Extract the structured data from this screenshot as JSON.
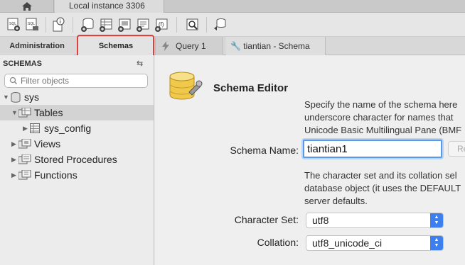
{
  "instance_tab": {
    "label": "Local instance 3306"
  },
  "toolbar": {
    "buttons": [
      "new-sql-tab-icon",
      "open-sql-script-icon",
      "inspector-icon",
      "create-schema-icon",
      "create-table-icon",
      "create-view-icon",
      "create-procedure-icon",
      "create-function-icon",
      "search-table-data-icon",
      "reconnect-icon"
    ]
  },
  "panel_tabs": {
    "administration": "Administration",
    "schemas": "Schemas"
  },
  "editor_tabs": [
    {
      "label": "Query 1"
    },
    {
      "label": "tiantian - Schema"
    }
  ],
  "sidebar": {
    "title": "SCHEMAS",
    "filter_placeholder": "Filter objects",
    "tree": [
      {
        "label": "sys"
      },
      {
        "label": "Tables"
      },
      {
        "label": "sys_config"
      },
      {
        "label": "Views"
      },
      {
        "label": "Stored Procedures"
      },
      {
        "label": "Functions"
      }
    ]
  },
  "editor": {
    "title": "Schema Editor",
    "name_description": [
      "Specify the name of the schema here",
      "underscore character for names that",
      "Unicode Basic Multilingual Pane (BMF"
    ],
    "schema_name_label": "Schema Name:",
    "schema_name_value": "tiantian1",
    "rename_button": "Re",
    "charset_description": [
      "The character set and its collation sel",
      "database object (it uses the DEFAULT",
      "server defaults."
    ],
    "charset_label": "Character Set:",
    "charset_value": "utf8",
    "collation_label": "Collation:",
    "collation_value": "utf8_unicode_ci"
  },
  "colors": {
    "accent": "#3b7ff0",
    "highlight": "#e0403a",
    "selected_row": "#d3d3d3"
  }
}
